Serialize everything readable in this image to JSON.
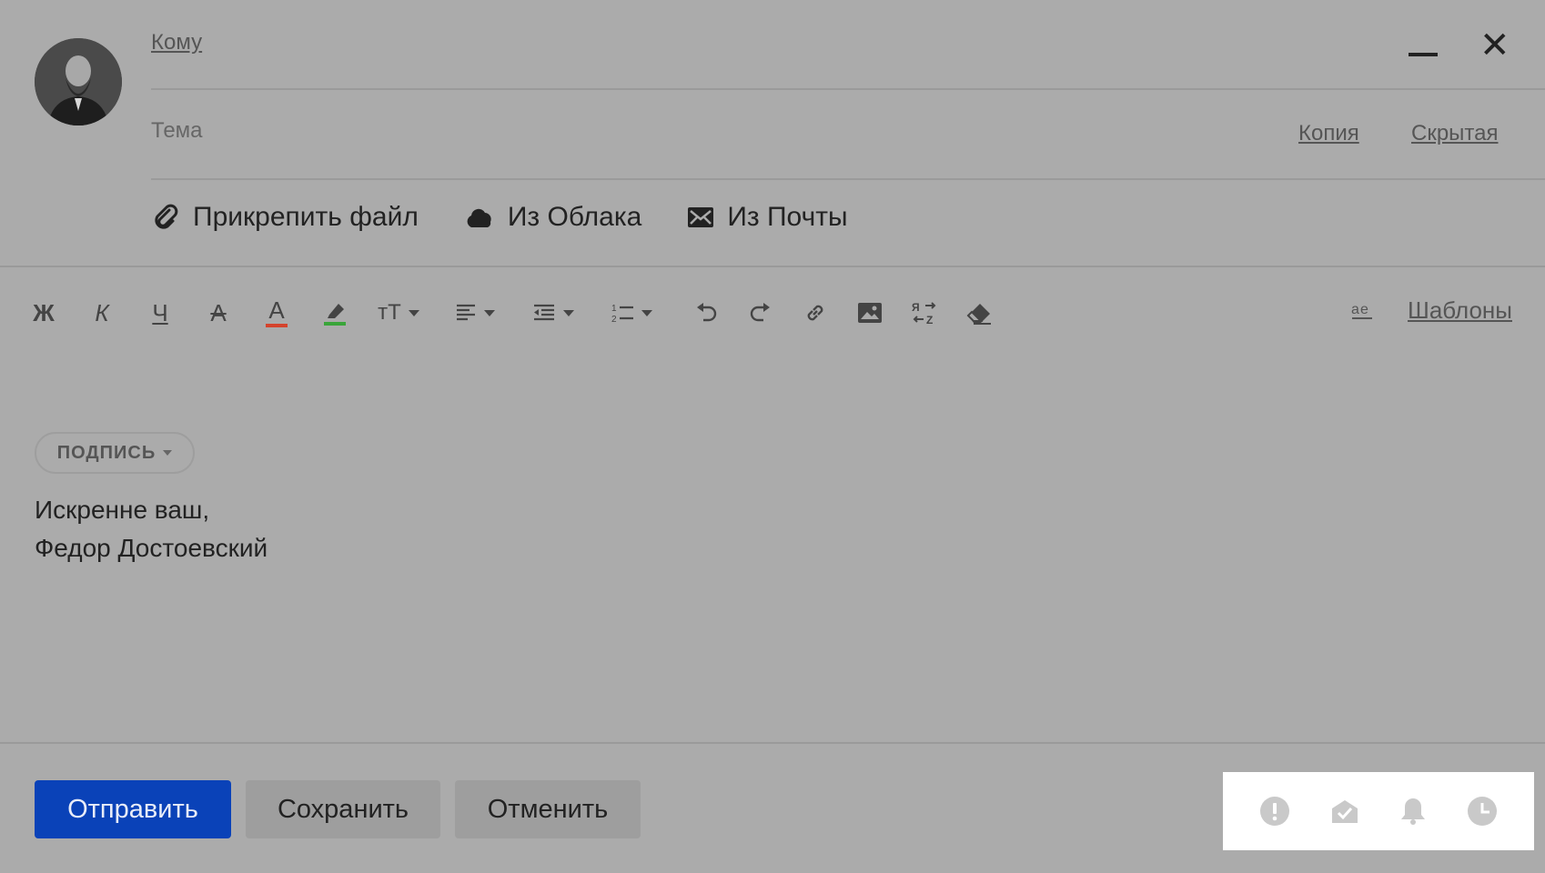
{
  "header": {
    "to_label": "Кому",
    "subject_label": "Тема",
    "cc_label": "Копия",
    "bcc_label": "Скрытая"
  },
  "attachments": {
    "attach_file": "Прикрепить файл",
    "from_cloud": "Из Облака",
    "from_mail": "Из Почты"
  },
  "toolbar": {
    "bold": "Ж",
    "italic": "К",
    "underline": "Ч",
    "strikethrough": "А",
    "text_color": "А",
    "text_color_hex": "#d4432c",
    "highlight_hex": "#3aa53a",
    "font_size": "тТ",
    "templates_label": "Шаблоны"
  },
  "signature": {
    "chip_label": "ПОДПИСЬ",
    "line1": "Искренне ваш,",
    "line2": "Федор Достоевский"
  },
  "footer": {
    "send_label": "Отправить",
    "save_label": "Сохранить",
    "cancel_label": "Отменить",
    "icons": [
      "important-icon",
      "read-receipt-icon",
      "reminder-icon",
      "schedule-icon"
    ]
  },
  "colors": {
    "primary": "#0a42b8",
    "overlay_bg": "#ababab"
  }
}
